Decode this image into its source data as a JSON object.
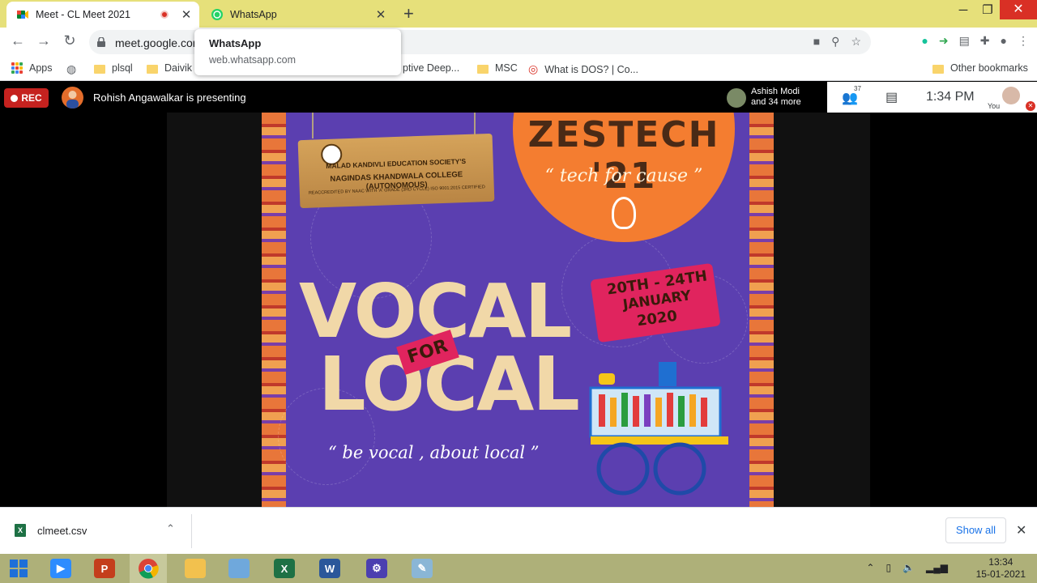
{
  "browser": {
    "tabs": [
      {
        "title": "Meet - CL Meet 2021",
        "favicon": "google-meet-icon",
        "recording": true
      },
      {
        "title": "WhatsApp",
        "favicon": "whatsapp-icon"
      }
    ],
    "window_controls": {
      "minimize": "─",
      "restore": "❐",
      "close": "✕"
    },
    "url": "meet.google.com",
    "tooltip": {
      "title": "WhatsApp",
      "url": "web.whatsapp.com"
    },
    "bookmarks": [
      {
        "label": "Apps",
        "icon": "apps-grid-icon"
      },
      {
        "label": "",
        "icon": "globe-icon"
      },
      {
        "label": "plsql",
        "icon": "folder-icon"
      },
      {
        "label": "Daivik",
        "icon": "folder-icon"
      },
      {
        "label": "ptive Deep...",
        "icon": "folder-icon"
      },
      {
        "label": "MSC",
        "icon": "folder-icon"
      },
      {
        "label": "What is DOS? | Co...",
        "icon": "site-icon"
      }
    ],
    "other_bookmarks": "Other bookmarks"
  },
  "meet": {
    "rec_label": "REC",
    "presenter_text": "Rohish Angawalkar is presenting",
    "participant_name": "Ashish Modi",
    "participant_more": "and 34 more",
    "people_count": "37",
    "time": "1:34 PM",
    "you_label": "You"
  },
  "poster": {
    "sign_line1": "MALAD KANDIVLI EDUCATION SOCIETY'S",
    "sign_line2": "NAGINDAS KHANDWALA COLLEGE (AUTONOMOUS)",
    "sign_line3": "REACCREDITED BY NAAC WITH 'A' GRADE (3RD CYCLE) ISO 9001:2015 CERTIFIED",
    "event_title": "ZESTECH '21",
    "tagline": "“ tech for cause ”",
    "date_line1": "20TH - 24TH",
    "date_line2": "JANUARY",
    "date_line3": "2020",
    "vocal": "VOCAL",
    "for": "FOR",
    "local": "LOCAL",
    "slogan": "“ be vocal , about local ”"
  },
  "downloads": {
    "file_name": "clmeet.csv",
    "show_all": "Show all"
  },
  "taskbar": {
    "clock_time": "13:34",
    "clock_date": "15-01-2021",
    "apps": [
      "start-icon",
      "zoom-icon",
      "powerpoint-icon",
      "chrome-icon",
      "file-explorer-icon",
      "notepad-icon",
      "excel-icon",
      "word-icon",
      "settings-icon",
      "paint-icon"
    ]
  },
  "colors": {
    "tabstrip": "#e6e07a",
    "poster_bg": "#5b3fb0",
    "accent_orange": "#f47d30",
    "accent_pink": "#e0245e",
    "rec_red": "#c5221f"
  }
}
